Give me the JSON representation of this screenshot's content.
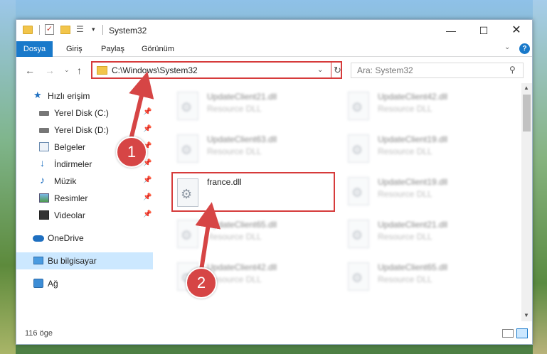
{
  "window": {
    "title": "System32",
    "controls": {
      "minimize": "—",
      "maximize": "☐",
      "close": "✕"
    }
  },
  "quick_access_toolbar": {
    "dropdown_glyph": "▾"
  },
  "ribbon": {
    "tabs": [
      "Dosya",
      "Giriş",
      "Paylaş",
      "Görünüm"
    ],
    "collapse_glyph": "⌄",
    "help_glyph": "?"
  },
  "navigation": {
    "back_glyph": "←",
    "forward_glyph": "→",
    "recent_glyph": "⌄",
    "up_glyph": "↑",
    "address": "C:\\Windows\\System32",
    "address_dropdown_glyph": "⌄",
    "refresh_glyph": "↻",
    "search_placeholder": "Ara: System32",
    "search_glyph": "⚲"
  },
  "sidebar": {
    "items": [
      {
        "label": "Hızlı erişim",
        "icon": "star-icon",
        "pinned": false
      },
      {
        "label": "Yerel Disk (C:)",
        "icon": "drive-icon",
        "pinned": true
      },
      {
        "label": "Yerel Disk (D:)",
        "icon": "drive-icon",
        "pinned": true
      },
      {
        "label": "Belgeler",
        "icon": "documents-icon",
        "pinned": true
      },
      {
        "label": "İndirmeler",
        "icon": "download-icon",
        "pinned": true
      },
      {
        "label": "Müzik",
        "icon": "music-icon",
        "pinned": true
      },
      {
        "label": "Resimler",
        "icon": "pictures-icon",
        "pinned": true
      },
      {
        "label": "Videolar",
        "icon": "videos-icon",
        "pinned": true
      },
      {
        "label": "OneDrive",
        "icon": "cloud-icon",
        "pinned": false
      },
      {
        "label": "Bu bilgisayar",
        "icon": "computer-icon",
        "pinned": false,
        "selected": true
      },
      {
        "label": "Ağ",
        "icon": "network-icon",
        "pinned": false
      }
    ],
    "pin_glyph": "📌"
  },
  "files": {
    "left_column": [
      {
        "name": "UpdateClient21.dll",
        "type": "Resource DLL"
      },
      {
        "name": "UpdateClient63.dll",
        "type": "Resource DLL"
      },
      {
        "name": "france.dll",
        "type": "",
        "highlighted": true
      },
      {
        "name": "UpdateClient65.dll",
        "type": "Resource DLL"
      },
      {
        "name": "UpdateClient42.dll",
        "type": "Resource DLL"
      }
    ],
    "right_column": [
      {
        "name": "UpdateClient42.dll",
        "type": "Resource DLL"
      },
      {
        "name": "UpdateClient19.dll",
        "type": "Resource DLL"
      },
      {
        "name": "UpdateClient19.dll",
        "type": "Resource DLL"
      },
      {
        "name": "UpdateClient21.dll",
        "type": "Resource DLL"
      },
      {
        "name": "UpdateClient65.dll",
        "type": "Resource DLL"
      }
    ],
    "file_icon_glyph": "⚙"
  },
  "scrollbar": {
    "up_glyph": "▲",
    "down_glyph": "▼"
  },
  "status": {
    "item_count": "116 öge"
  },
  "annotations": {
    "step1": "1",
    "step2": "2",
    "color": "#d64545"
  }
}
